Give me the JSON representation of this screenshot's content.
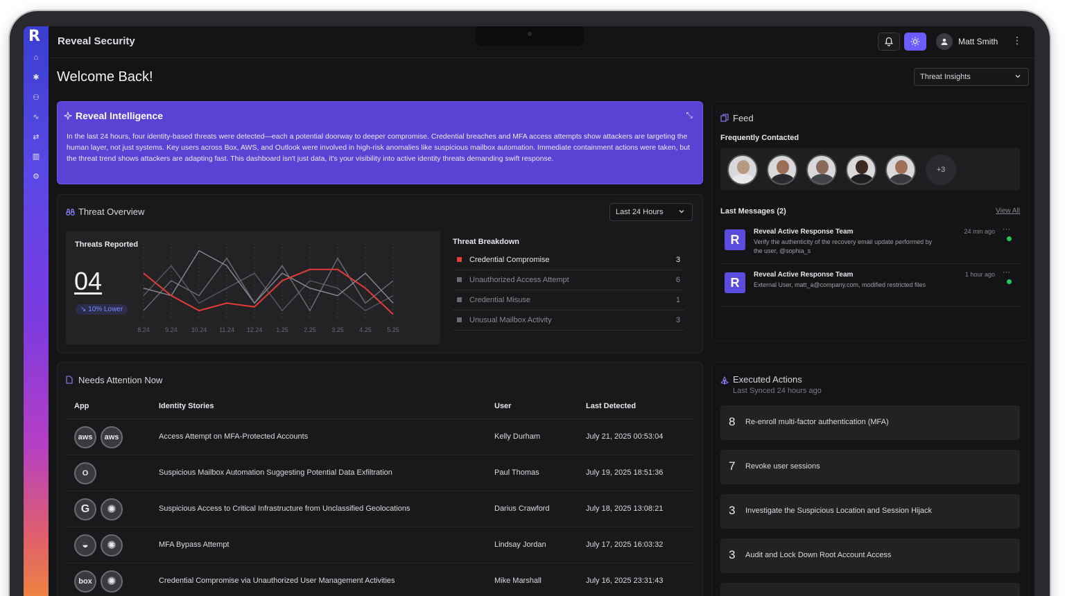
{
  "app": {
    "brand": "Reveal Security",
    "logo": "R"
  },
  "header": {
    "user_name": "Matt Smith",
    "view_select": "Threat Insights"
  },
  "welcome": "Welcome Back!",
  "intelligence": {
    "title": "Reveal Intelligence",
    "text": "In the last 24 hours, four identity-based threats were detected—each a potential doorway to deeper compromise. Credential breaches and MFA access attempts show attackers are targeting the human layer, not just systems. Key users across Box, AWS, and Outlook were involved in high-risk anomalies like suspicious mailbox automation. Immediate containment actions were taken, but the threat trend shows attackers are adapting fast. This dashboard isn't just data, it's your visibility into active identity threats demanding swift response."
  },
  "overview": {
    "title": "Threat Overview",
    "range": "Last 24 Hours",
    "threats_label": "Threats Reported",
    "threats_value": "04",
    "trend_badge": "10% Lower",
    "breakdown_title": "Threat Breakdown",
    "breakdown": [
      {
        "name": "Credential Compromise",
        "count": "3"
      },
      {
        "name": "Unauthorized Access Attempt",
        "count": "6"
      },
      {
        "name": "Credential Misuse",
        "count": "1"
      },
      {
        "name": "Unusual Mailbox Activity",
        "count": "3"
      }
    ]
  },
  "chart_data": {
    "type": "line",
    "categories": [
      "8.24",
      "9.24",
      "10.24",
      "11.24",
      "12.24",
      "1.25",
      "2.25",
      "3.25",
      "4.25",
      "5.25"
    ],
    "series": [
      {
        "color": "#e53b3b",
        "values": [
          6,
          3,
          1,
          2,
          1.5,
          5,
          6.5,
          6.5,
          4,
          0.5
        ]
      },
      {
        "color": "#8a8a90",
        "values": [
          4,
          3,
          9,
          7,
          2,
          6,
          4,
          3,
          6,
          2
        ]
      },
      {
        "color": "#6e6e74",
        "values": [
          1,
          5,
          3,
          8,
          2,
          7,
          1,
          8,
          2,
          5
        ]
      },
      {
        "color": "#58585e",
        "values": [
          3,
          7,
          2,
          4,
          6,
          1,
          5,
          4,
          1,
          3
        ]
      }
    ],
    "ylim": [
      0,
      10
    ]
  },
  "feed": {
    "title": "Feed",
    "frequently_contacted": "Frequently Contacted",
    "more_count": "+3",
    "last_messages": "Last Messages (2)",
    "view_all": "View All",
    "messages": [
      {
        "from": "Reveal Active Response Team",
        "text": "Verify the authenticity of the recovery email update performed by the user, @sophia_s",
        "time": "24 min ago"
      },
      {
        "from": "Reveal Active Response Team",
        "text": "External User, matt_a@company.com, modified restricted files",
        "time": "1 hour ago"
      }
    ]
  },
  "needs": {
    "title": "Needs Attention Now",
    "columns": [
      "App",
      "Identity Stories",
      "User",
      "Last Detected"
    ],
    "rows": [
      {
        "apps": [
          "aws",
          "aws"
        ],
        "story": "Access Attempt on MFA-Protected Accounts",
        "user": "Kelly Durham",
        "detected": "July 21, 2025 00:53:04"
      },
      {
        "apps": [
          "O"
        ],
        "story": "Suspicious Mailbox Automation Suggesting Potential Data Exfiltration",
        "user": "Paul Thomas",
        "detected": "July 19, 2025 18:51:36"
      },
      {
        "apps": [
          "G",
          "✺"
        ],
        "story": "Suspicious Access to Critical Infrastructure from Unclassified Geolocations",
        "user": "Darius Crawford",
        "detected": "July 18, 2025 13:08:21"
      },
      {
        "apps": [
          "◒",
          "✺"
        ],
        "story": "MFA Bypass Attempt",
        "user": "Lindsay Jordan",
        "detected": "July 17, 2025 16:03:32"
      },
      {
        "apps": [
          "box",
          "✺"
        ],
        "story": "Credential Compromise via Unauthorized User Management Activities",
        "user": "Mike Marshall",
        "detected": "July 16, 2025 23:31:43"
      }
    ]
  },
  "exec": {
    "title": "Executed Actions",
    "subtitle": "Last Synced 24 hours ago",
    "actions": [
      {
        "num": "8",
        "text": "Re-enroll multi-factor authentication (MFA)"
      },
      {
        "num": "7",
        "text": "Revoke user sessions"
      },
      {
        "num": "3",
        "text": "Investigate the Suspicious Location and Session Hijack"
      },
      {
        "num": "3",
        "text": "Audit and Lock Down Root Account Access"
      }
    ]
  }
}
